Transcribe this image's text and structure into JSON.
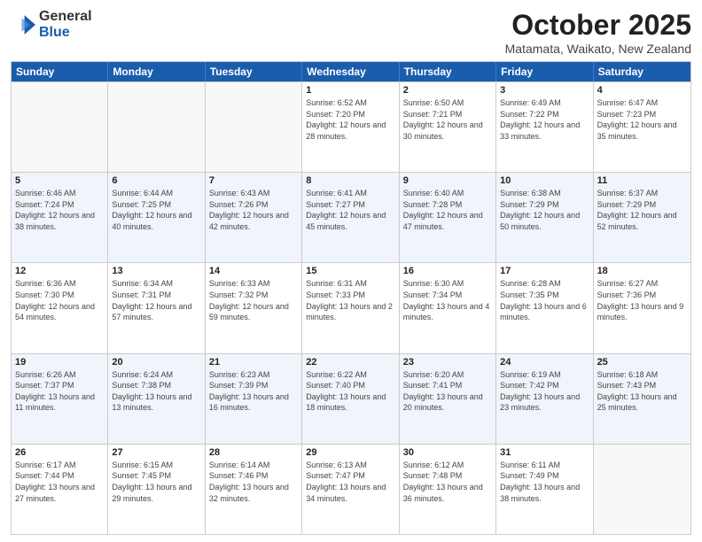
{
  "logo": {
    "general": "General",
    "blue": "Blue"
  },
  "header": {
    "month": "October 2025",
    "location": "Matamata, Waikato, New Zealand"
  },
  "days_of_week": [
    "Sunday",
    "Monday",
    "Tuesday",
    "Wednesday",
    "Thursday",
    "Friday",
    "Saturday"
  ],
  "weeks": [
    [
      {
        "day": "",
        "empty": true
      },
      {
        "day": "",
        "empty": true
      },
      {
        "day": "",
        "empty": true
      },
      {
        "day": "1",
        "sunrise": "Sunrise: 6:52 AM",
        "sunset": "Sunset: 7:20 PM",
        "daylight": "Daylight: 12 hours and 28 minutes."
      },
      {
        "day": "2",
        "sunrise": "Sunrise: 6:50 AM",
        "sunset": "Sunset: 7:21 PM",
        "daylight": "Daylight: 12 hours and 30 minutes."
      },
      {
        "day": "3",
        "sunrise": "Sunrise: 6:49 AM",
        "sunset": "Sunset: 7:22 PM",
        "daylight": "Daylight: 12 hours and 33 minutes."
      },
      {
        "day": "4",
        "sunrise": "Sunrise: 6:47 AM",
        "sunset": "Sunset: 7:23 PM",
        "daylight": "Daylight: 12 hours and 35 minutes."
      }
    ],
    [
      {
        "day": "5",
        "sunrise": "Sunrise: 6:46 AM",
        "sunset": "Sunset: 7:24 PM",
        "daylight": "Daylight: 12 hours and 38 minutes."
      },
      {
        "day": "6",
        "sunrise": "Sunrise: 6:44 AM",
        "sunset": "Sunset: 7:25 PM",
        "daylight": "Daylight: 12 hours and 40 minutes."
      },
      {
        "day": "7",
        "sunrise": "Sunrise: 6:43 AM",
        "sunset": "Sunset: 7:26 PM",
        "daylight": "Daylight: 12 hours and 42 minutes."
      },
      {
        "day": "8",
        "sunrise": "Sunrise: 6:41 AM",
        "sunset": "Sunset: 7:27 PM",
        "daylight": "Daylight: 12 hours and 45 minutes."
      },
      {
        "day": "9",
        "sunrise": "Sunrise: 6:40 AM",
        "sunset": "Sunset: 7:28 PM",
        "daylight": "Daylight: 12 hours and 47 minutes."
      },
      {
        "day": "10",
        "sunrise": "Sunrise: 6:38 AM",
        "sunset": "Sunset: 7:29 PM",
        "daylight": "Daylight: 12 hours and 50 minutes."
      },
      {
        "day": "11",
        "sunrise": "Sunrise: 6:37 AM",
        "sunset": "Sunset: 7:29 PM",
        "daylight": "Daylight: 12 hours and 52 minutes."
      }
    ],
    [
      {
        "day": "12",
        "sunrise": "Sunrise: 6:36 AM",
        "sunset": "Sunset: 7:30 PM",
        "daylight": "Daylight: 12 hours and 54 minutes."
      },
      {
        "day": "13",
        "sunrise": "Sunrise: 6:34 AM",
        "sunset": "Sunset: 7:31 PM",
        "daylight": "Daylight: 12 hours and 57 minutes."
      },
      {
        "day": "14",
        "sunrise": "Sunrise: 6:33 AM",
        "sunset": "Sunset: 7:32 PM",
        "daylight": "Daylight: 12 hours and 59 minutes."
      },
      {
        "day": "15",
        "sunrise": "Sunrise: 6:31 AM",
        "sunset": "Sunset: 7:33 PM",
        "daylight": "Daylight: 13 hours and 2 minutes."
      },
      {
        "day": "16",
        "sunrise": "Sunrise: 6:30 AM",
        "sunset": "Sunset: 7:34 PM",
        "daylight": "Daylight: 13 hours and 4 minutes."
      },
      {
        "day": "17",
        "sunrise": "Sunrise: 6:28 AM",
        "sunset": "Sunset: 7:35 PM",
        "daylight": "Daylight: 13 hours and 6 minutes."
      },
      {
        "day": "18",
        "sunrise": "Sunrise: 6:27 AM",
        "sunset": "Sunset: 7:36 PM",
        "daylight": "Daylight: 13 hours and 9 minutes."
      }
    ],
    [
      {
        "day": "19",
        "sunrise": "Sunrise: 6:26 AM",
        "sunset": "Sunset: 7:37 PM",
        "daylight": "Daylight: 13 hours and 11 minutes."
      },
      {
        "day": "20",
        "sunrise": "Sunrise: 6:24 AM",
        "sunset": "Sunset: 7:38 PM",
        "daylight": "Daylight: 13 hours and 13 minutes."
      },
      {
        "day": "21",
        "sunrise": "Sunrise: 6:23 AM",
        "sunset": "Sunset: 7:39 PM",
        "daylight": "Daylight: 13 hours and 16 minutes."
      },
      {
        "day": "22",
        "sunrise": "Sunrise: 6:22 AM",
        "sunset": "Sunset: 7:40 PM",
        "daylight": "Daylight: 13 hours and 18 minutes."
      },
      {
        "day": "23",
        "sunrise": "Sunrise: 6:20 AM",
        "sunset": "Sunset: 7:41 PM",
        "daylight": "Daylight: 13 hours and 20 minutes."
      },
      {
        "day": "24",
        "sunrise": "Sunrise: 6:19 AM",
        "sunset": "Sunset: 7:42 PM",
        "daylight": "Daylight: 13 hours and 23 minutes."
      },
      {
        "day": "25",
        "sunrise": "Sunrise: 6:18 AM",
        "sunset": "Sunset: 7:43 PM",
        "daylight": "Daylight: 13 hours and 25 minutes."
      }
    ],
    [
      {
        "day": "26",
        "sunrise": "Sunrise: 6:17 AM",
        "sunset": "Sunset: 7:44 PM",
        "daylight": "Daylight: 13 hours and 27 minutes."
      },
      {
        "day": "27",
        "sunrise": "Sunrise: 6:15 AM",
        "sunset": "Sunset: 7:45 PM",
        "daylight": "Daylight: 13 hours and 29 minutes."
      },
      {
        "day": "28",
        "sunrise": "Sunrise: 6:14 AM",
        "sunset": "Sunset: 7:46 PM",
        "daylight": "Daylight: 13 hours and 32 minutes."
      },
      {
        "day": "29",
        "sunrise": "Sunrise: 6:13 AM",
        "sunset": "Sunset: 7:47 PM",
        "daylight": "Daylight: 13 hours and 34 minutes."
      },
      {
        "day": "30",
        "sunrise": "Sunrise: 6:12 AM",
        "sunset": "Sunset: 7:48 PM",
        "daylight": "Daylight: 13 hours and 36 minutes."
      },
      {
        "day": "31",
        "sunrise": "Sunrise: 6:11 AM",
        "sunset": "Sunset: 7:49 PM",
        "daylight": "Daylight: 13 hours and 38 minutes."
      },
      {
        "day": "",
        "empty": true
      }
    ]
  ]
}
